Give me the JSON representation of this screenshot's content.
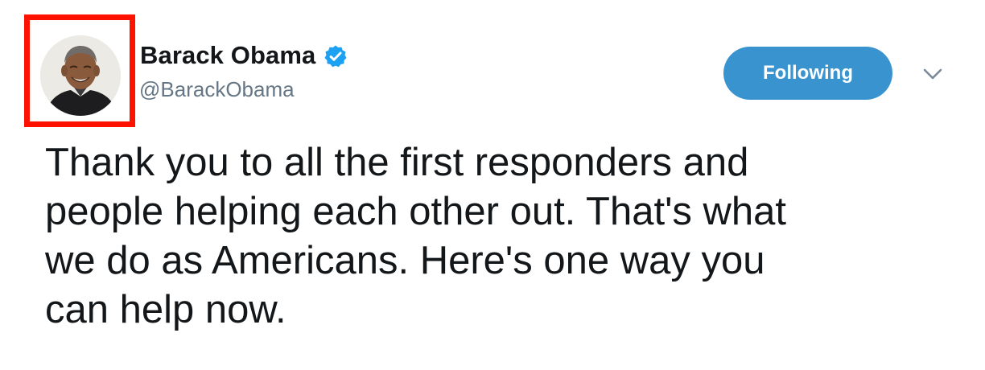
{
  "author": {
    "display_name": "Barack Obama",
    "handle": "@BarackObama",
    "verified": true,
    "avatar_icon": "profile-photo"
  },
  "actions": {
    "follow_label": "Following",
    "caret_icon": "chevron-down-icon"
  },
  "tweet": {
    "text": "Thank you to all the first responders and\npeople helping each other out. That's what\nwe do as Americans. Here's one way you\ncan help now."
  },
  "colors": {
    "highlight_box": "#ff1200",
    "follow_button": "#3893cf",
    "verified_badge": "#1da1f2",
    "handle_text": "#657786",
    "body_text": "#14171a"
  }
}
